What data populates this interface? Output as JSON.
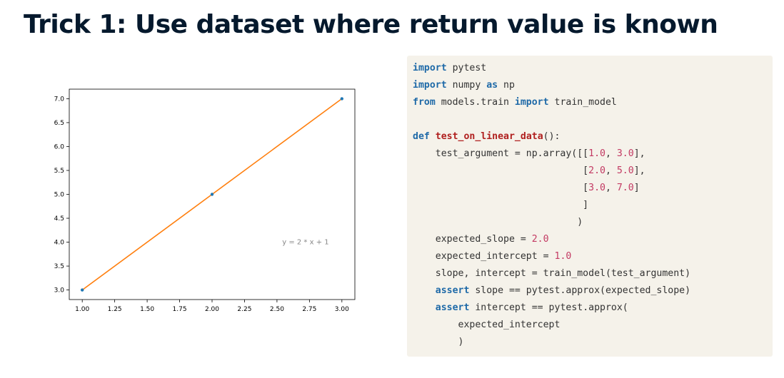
{
  "title": "Trick 1: Use dataset where return value is known",
  "chart_data": {
    "type": "line",
    "x": [
      1.0,
      2.0,
      3.0
    ],
    "y": [
      3.0,
      5.0,
      7.0
    ],
    "line_color": "#ff7f0e",
    "marker_color": "#1f77b4",
    "xlim": [
      1.0,
      3.0
    ],
    "ylim": [
      3.0,
      7.0
    ],
    "xticks": [
      "1.00",
      "1.25",
      "1.50",
      "1.75",
      "2.00",
      "2.25",
      "2.50",
      "2.75",
      "3.00"
    ],
    "yticks": [
      "3.0",
      "3.5",
      "4.0",
      "4.5",
      "5.0",
      "5.5",
      "6.0",
      "6.5",
      "7.0"
    ],
    "annotation": {
      "text": "y = 2 * x + 1",
      "x": 2.9,
      "y": 4.0
    },
    "grid": false,
    "xlabel": "",
    "ylabel": ""
  },
  "code": {
    "lines": [
      [
        {
          "t": "import",
          "k": "kw"
        },
        {
          "t": " pytest"
        }
      ],
      [
        {
          "t": "import",
          "k": "kw"
        },
        {
          "t": " numpy "
        },
        {
          "t": "as",
          "k": "kw"
        },
        {
          "t": " np"
        }
      ],
      [
        {
          "t": "from",
          "k": "kw"
        },
        {
          "t": " models.train "
        },
        {
          "t": "import",
          "k": "kw"
        },
        {
          "t": " train_model"
        }
      ],
      [],
      [
        {
          "t": "def",
          "k": "kw"
        },
        {
          "t": " "
        },
        {
          "t": "test_on_linear_data",
          "k": "fn"
        },
        {
          "t": "():"
        }
      ],
      [
        {
          "t": "    test_argument = np.array([["
        },
        {
          "t": "1.0",
          "k": "num"
        },
        {
          "t": ", "
        },
        {
          "t": "3.0",
          "k": "num"
        },
        {
          "t": "],"
        }
      ],
      [
        {
          "t": "                              ["
        },
        {
          "t": "2.0",
          "k": "num"
        },
        {
          "t": ", "
        },
        {
          "t": "5.0",
          "k": "num"
        },
        {
          "t": "],"
        }
      ],
      [
        {
          "t": "                              ["
        },
        {
          "t": "3.0",
          "k": "num"
        },
        {
          "t": ", "
        },
        {
          "t": "7.0",
          "k": "num"
        },
        {
          "t": "]"
        }
      ],
      [
        {
          "t": "                              ]"
        }
      ],
      [
        {
          "t": "                             )"
        }
      ],
      [
        {
          "t": "    expected_slope = "
        },
        {
          "t": "2.0",
          "k": "num"
        }
      ],
      [
        {
          "t": "    expected_intercept = "
        },
        {
          "t": "1.0",
          "k": "num"
        }
      ],
      [
        {
          "t": "    slope, intercept = train_model(test_argument)"
        }
      ],
      [
        {
          "t": "    "
        },
        {
          "t": "assert",
          "k": "kw"
        },
        {
          "t": " slope == pytest.approx(expected_slope)"
        }
      ],
      [
        {
          "t": "    "
        },
        {
          "t": "assert",
          "k": "kw"
        },
        {
          "t": " intercept == pytest.approx("
        }
      ],
      [
        {
          "t": "        expected_intercept"
        }
      ],
      [
        {
          "t": "        )"
        }
      ]
    ]
  }
}
